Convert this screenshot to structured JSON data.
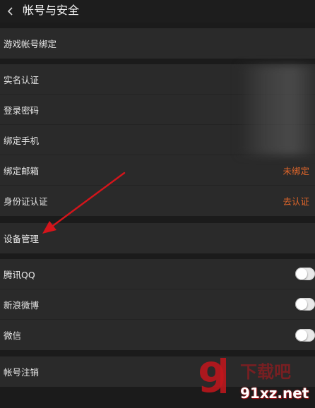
{
  "header": {
    "title": "帐号与安全"
  },
  "sections": {
    "game": [
      {
        "label": "游戏帐号绑定",
        "value": ""
      }
    ],
    "identity": [
      {
        "label": "实名认证",
        "value": ""
      },
      {
        "label": "登录密码",
        "value": ""
      },
      {
        "label": "绑定手机",
        "value": ""
      },
      {
        "label": "绑定邮箱",
        "value": "未绑定"
      },
      {
        "label": "身份证认证",
        "value": "去认证"
      }
    ],
    "device": [
      {
        "label": "设备管理"
      }
    ],
    "social": [
      {
        "label": "腾讯QQ",
        "enabled": false
      },
      {
        "label": "新浪微博",
        "enabled": false
      },
      {
        "label": "微信",
        "enabled": false
      }
    ],
    "account": [
      {
        "label": "帐号注销"
      }
    ]
  },
  "colors": {
    "background": "#1b1b1b",
    "row": "#2a2a2a",
    "accent": "#e0662a",
    "arrow": "#d4151b"
  },
  "icons": {
    "back": "chevron-left-icon"
  },
  "watermark": {
    "text": "91xz.net",
    "logo": "9下载吧"
  }
}
